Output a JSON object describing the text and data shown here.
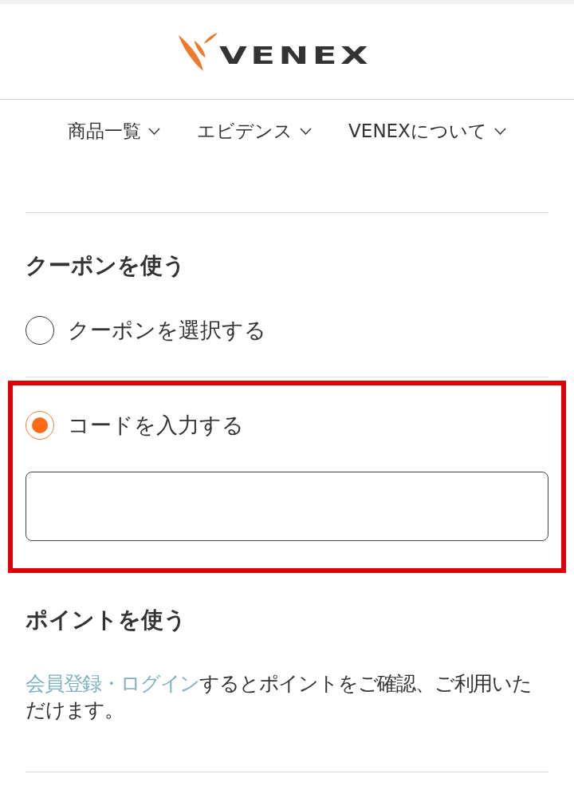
{
  "header": {
    "logo": "VENEX"
  },
  "nav": [
    {
      "label": "商品一覧",
      "expanded": false
    },
    {
      "label": "エビデンス",
      "expanded": false
    },
    {
      "label": "VENEXについて",
      "expanded": false
    }
  ],
  "coupon": {
    "title": "クーポンを使う",
    "options": [
      {
        "kind": "select",
        "label": "クーポンを選択する",
        "selected": false,
        "highlighted": false
      },
      {
        "kind": "code",
        "label": "コードを入力する",
        "selected": true,
        "highlighted": true
      }
    ]
  },
  "points": {
    "title": "ポイントを使う",
    "link": "会員登録・ログイン",
    "text": "するとポイントをご確認、ご利用いただけます。"
  }
}
